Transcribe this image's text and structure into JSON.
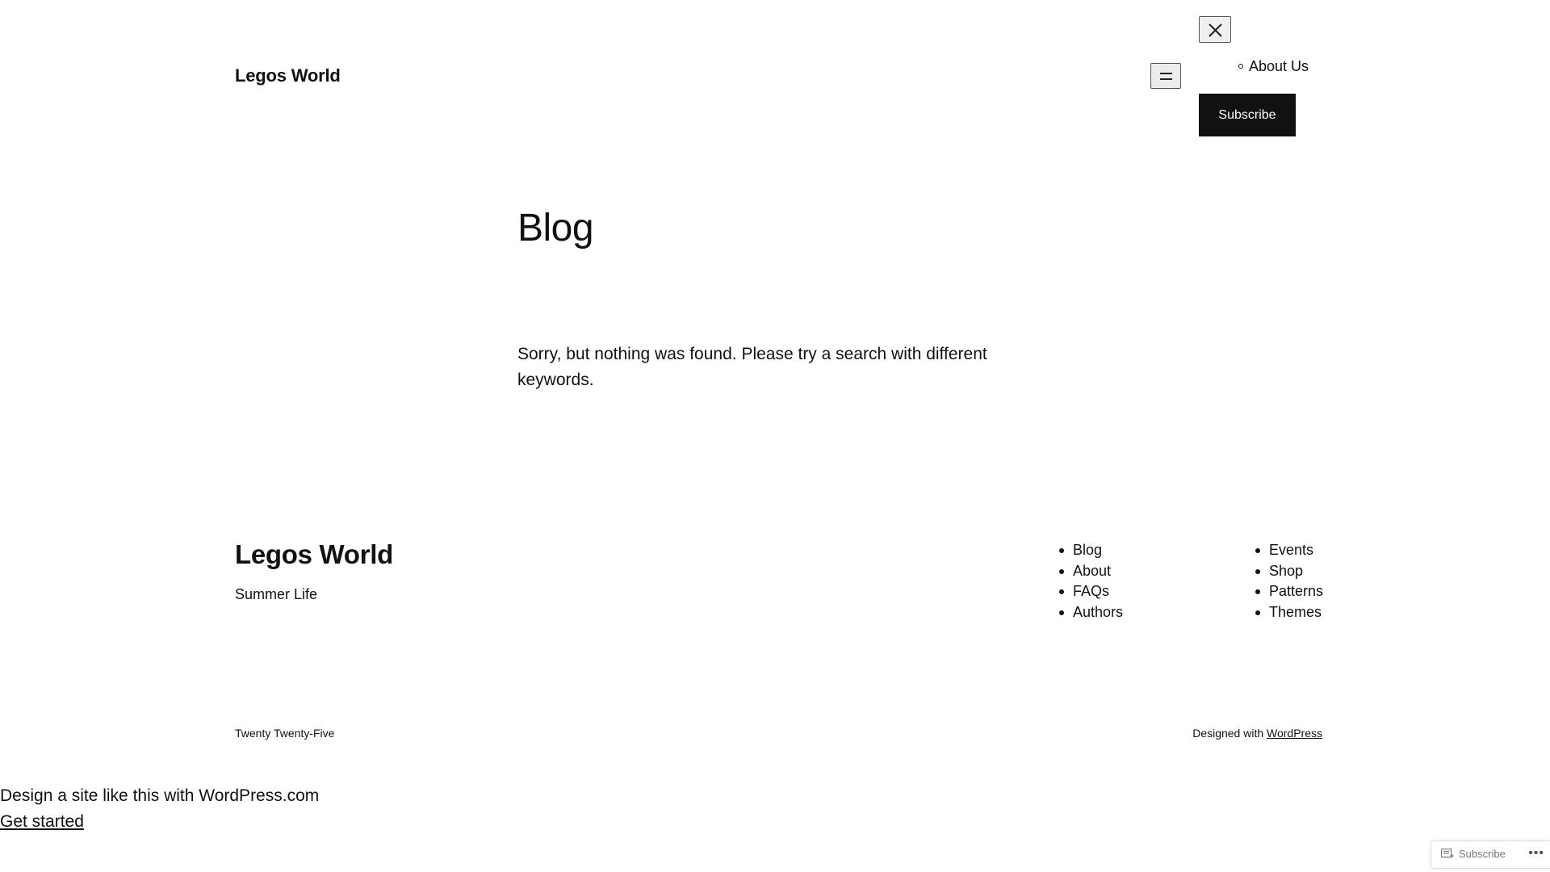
{
  "header": {
    "site_title": "Legos World",
    "menu_items": [
      "About Us"
    ],
    "subscribe_label": "Subscribe",
    "icons": {
      "menu": "hamburger-menu-icon",
      "close": "close-icon"
    }
  },
  "main": {
    "title": "Blog",
    "message": "Sorry, but nothing was found. Please try a search with different keywords."
  },
  "footer": {
    "site_title": "Legos World",
    "tagline": "Summer Life",
    "nav_col1": [
      "Blog",
      "About",
      "FAQs",
      "Authors"
    ],
    "nav_col2": [
      "Events",
      "Shop",
      "Patterns",
      "Themes"
    ],
    "theme_name": "Twenty Twenty-Five",
    "designed_with_prefix": "Designed with ",
    "designed_with_link": "WordPress"
  },
  "promo": {
    "text": "Design a site like this with WordPress.com",
    "link": "Get started"
  },
  "action_bar": {
    "subscribe_label": "Subscribe",
    "more_label": "•••"
  },
  "colors": {
    "text": "#111111",
    "background": "#ffffff",
    "button_bg": "#111111",
    "button_text": "#ffffff"
  }
}
